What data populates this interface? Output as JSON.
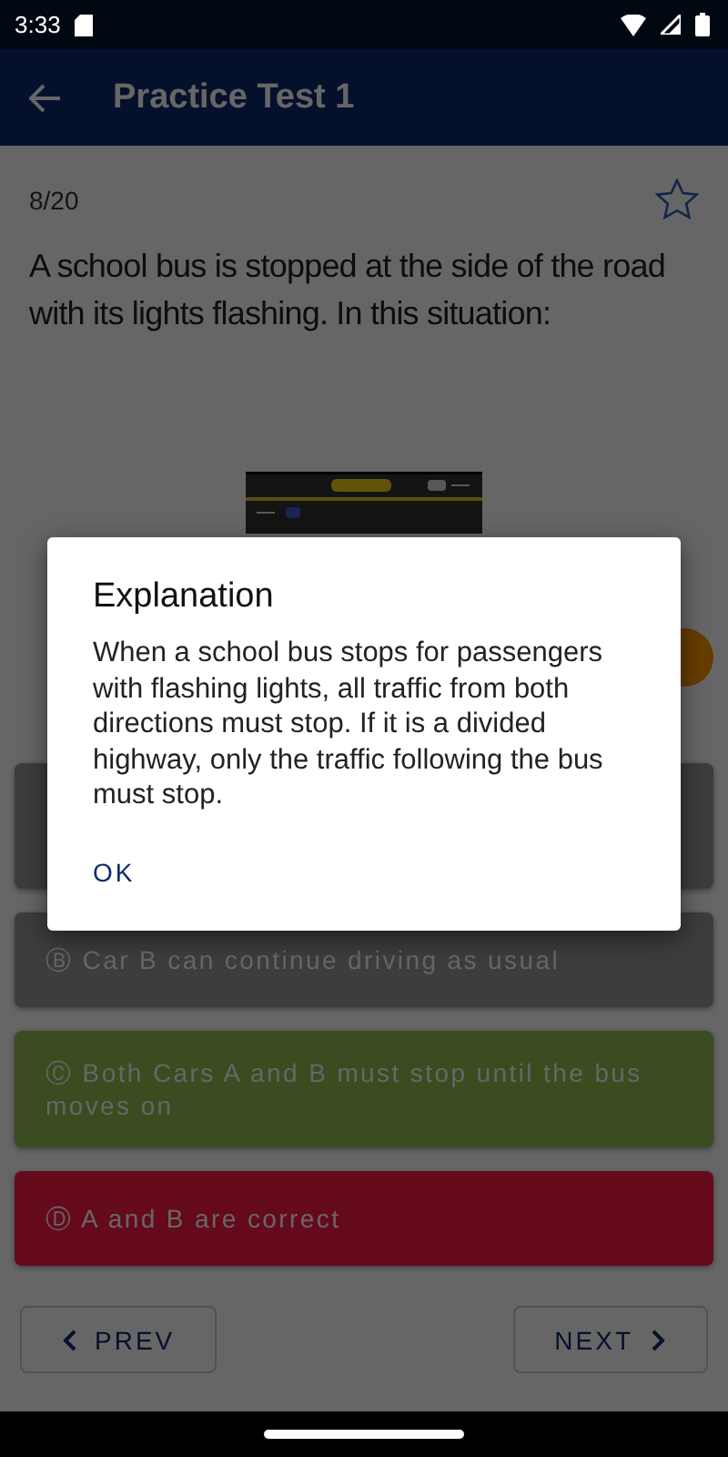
{
  "status_bar": {
    "time": "3:33"
  },
  "app_bar": {
    "title": "Practice Test 1"
  },
  "question": {
    "counter": "8/20",
    "starred": false,
    "text": "A school bus is stopped at the side of the road with its lights flashing. In this situation:"
  },
  "options": [
    {
      "correct": false,
      "incorrect": false
    },
    {
      "correct": false,
      "incorrect": false,
      "letter": "Ⓑ",
      "label": "Car B can continue driving as usual"
    },
    {
      "correct": true,
      "incorrect": false,
      "letter": "Ⓒ",
      "label": "Both Cars A and B must stop until the bus moves on"
    },
    {
      "correct": false,
      "incorrect": true,
      "letter": "Ⓓ",
      "label": "A and B are correct"
    }
  ],
  "nav": {
    "prev": "PREV",
    "next": "NEXT"
  },
  "dialog": {
    "title": "Explanation",
    "body": "When a school bus stops for passengers with flashing lights, all traffic from both directions must stop. If it is a divided highway, only the traffic following the bus must stop.",
    "button": "OK"
  }
}
